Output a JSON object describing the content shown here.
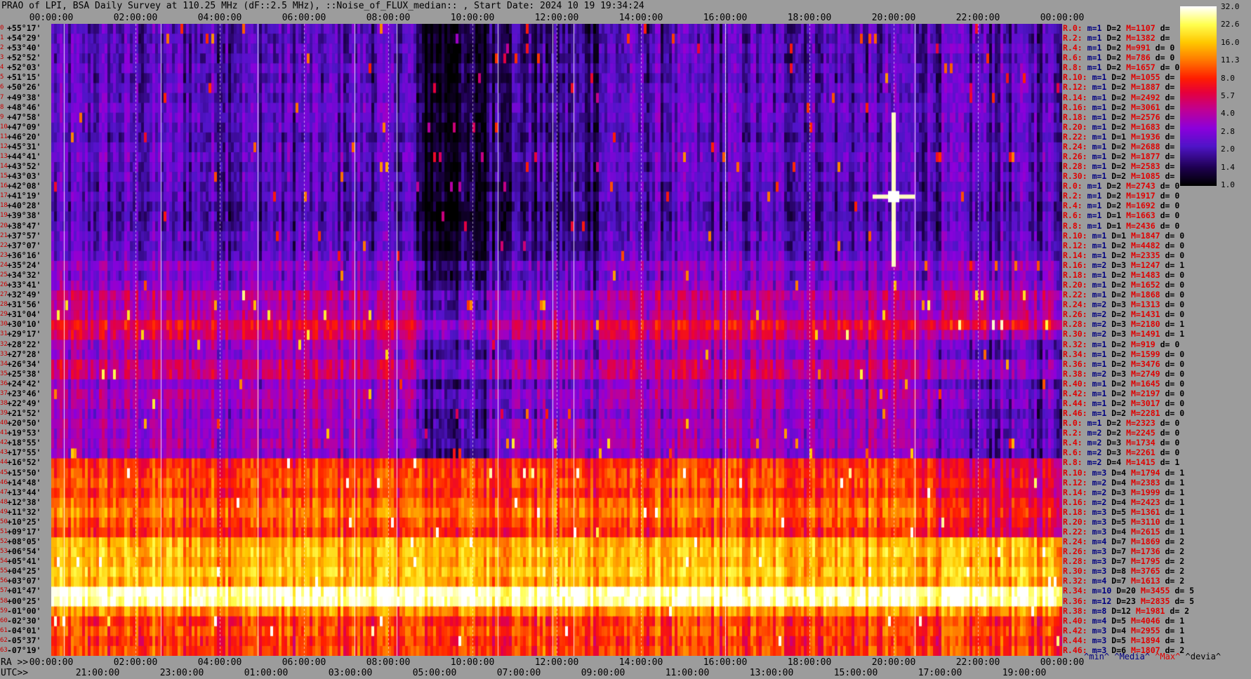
{
  "title": "PRAO of LPI, BSA Daily Survey at 110.25 MHz (dF::2.5 MHz), ::Noise_of_FLUX_median:: , Start Date: 2024 10 19 19:34:24",
  "top_axis_labels": [
    "00:00:00",
    "02:00:00",
    "04:00:00",
    "06:00:00",
    "08:00:00",
    "10:00:00",
    "12:00:00",
    "14:00:00",
    "16:00:00",
    "18:00:00",
    "20:00:00",
    "22:00:00",
    "00:00:00"
  ],
  "ra_prefix": "RA >>",
  "ra_axis_labels": [
    "00:00:00",
    "02:00:00",
    "04:00:00",
    "06:00:00",
    "08:00:00",
    "10:00:00",
    "12:00:00",
    "14:00:00",
    "16:00:00",
    "18:00:00",
    "20:00:00",
    "22:00:00",
    "00:00:00"
  ],
  "utc_prefix": "UTC>>",
  "utc_axis_labels": [
    "21:00:00",
    "23:00:00",
    "01:00:00",
    "03:00:00",
    "05:00:00",
    "07:00:00",
    "09:00:00",
    "11:00:00",
    "13:00:00",
    "15:00:00",
    "17:00:00",
    "19:00:00"
  ],
  "declinations": [
    "+55°17'",
    "+54°29'",
    "+53°40'",
    "+52°52'",
    "+52°03'",
    "+51°15'",
    "+50°26'",
    "+49°38'",
    "+48°46'",
    "+47°58'",
    "+47°09'",
    "+46°20'",
    "+45°31'",
    "+44°41'",
    "+43°52'",
    "+43°03'",
    "+42°08'",
    "+41°19'",
    "+40°28'",
    "+39°38'",
    "+38°47'",
    "+37°57'",
    "+37°07'",
    "+36°16'",
    "+35°24'",
    "+34°32'",
    "+33°41'",
    "+32°49'",
    "+31°56'",
    "+31°04'",
    "+30°10'",
    "+29°17'",
    "+28°22'",
    "+27°28'",
    "+26°34'",
    "+25°38'",
    "+24°42'",
    "+23°46'",
    "+22°49'",
    "+21°52'",
    "+20°50'",
    "+19°53'",
    "+18°55'",
    "+17°55'",
    "+16°52'",
    "+15°50'",
    "+14°48'",
    "+13°44'",
    "+12°38'",
    "+11°32'",
    "+10°25'",
    "+09°17'",
    "+08°05'",
    "+06°54'",
    "+05°41'",
    "+04°25'",
    "+03°07'",
    "+01°47'",
    "+00°25'",
    "-01°00'",
    "-02°30'",
    "-04°01'",
    "-05°37'",
    "-07°19'"
  ],
  "stats_rows": [
    {
      "beam": "R.0:",
      "m": "m=1",
      "D": "D=2",
      "M": "M=1107",
      "d": "d="
    },
    {
      "beam": "R.2:",
      "m": "m=1",
      "D": "D=2",
      "M": "M=1382",
      "d": "d="
    },
    {
      "beam": "R.4:",
      "m": "m=1",
      "D": "D=2",
      "M": "M=991",
      "d": "d= 0"
    },
    {
      "beam": "R.6:",
      "m": "m=1",
      "D": "D=2",
      "M": "M=786",
      "d": "d= 0"
    },
    {
      "beam": "R.8:",
      "m": "m=1",
      "D": "D=2",
      "M": "M=1657",
      "d": "d= 0"
    },
    {
      "beam": "R.10:",
      "m": "m=1",
      "D": "D=2",
      "M": "M=1055",
      "d": "d="
    },
    {
      "beam": "R.12:",
      "m": "m=1",
      "D": "D=2",
      "M": "M=1887",
      "d": "d="
    },
    {
      "beam": "R.14:",
      "m": "m=1",
      "D": "D=2",
      "M": "M=2492",
      "d": "d="
    },
    {
      "beam": "R.16:",
      "m": "m=1",
      "D": "D=2",
      "M": "M=3061",
      "d": "d="
    },
    {
      "beam": "R.18:",
      "m": "m=1",
      "D": "D=2",
      "M": "M=2576",
      "d": "d="
    },
    {
      "beam": "R.20:",
      "m": "m=1",
      "D": "D=2",
      "M": "M=1683",
      "d": "d="
    },
    {
      "beam": "R.22:",
      "m": "m=1",
      "D": "D=1",
      "M": "M=1936",
      "d": "d="
    },
    {
      "beam": "R.24:",
      "m": "m=1",
      "D": "D=2",
      "M": "M=2688",
      "d": "d="
    },
    {
      "beam": "R.26:",
      "m": "m=1",
      "D": "D=2",
      "M": "M=1877",
      "d": "d="
    },
    {
      "beam": "R.28:",
      "m": "m=1",
      "D": "D=2",
      "M": "M=2583",
      "d": "d="
    },
    {
      "beam": "R.30:",
      "m": "m=1",
      "D": "D=2",
      "M": "M=1085",
      "d": "d="
    },
    {
      "beam": "R.0:",
      "m": "m=1",
      "D": "D=2",
      "M": "M=2743",
      "d": "d= 0"
    },
    {
      "beam": "R.2:",
      "m": "m=1",
      "D": "D=2",
      "M": "M=1917",
      "d": "d= 0"
    },
    {
      "beam": "R.4:",
      "m": "m=1",
      "D": "D=2",
      "M": "M=1692",
      "d": "d= 0"
    },
    {
      "beam": "R.6:",
      "m": "m=1",
      "D": "D=1",
      "M": "M=1663",
      "d": "d= 0"
    },
    {
      "beam": "R.8:",
      "m": "m=1",
      "D": "D=1",
      "M": "M=2436",
      "d": "d= 0"
    },
    {
      "beam": "R.10:",
      "m": "m=1",
      "D": "D=1",
      "M": "M=1847",
      "d": "d= 0"
    },
    {
      "beam": "R.12:",
      "m": "m=1",
      "D": "D=2",
      "M": "M=4482",
      "d": "d= 0"
    },
    {
      "beam": "R.14:",
      "m": "m=1",
      "D": "D=2",
      "M": "M=2335",
      "d": "d= 0"
    },
    {
      "beam": "R.16:",
      "m": "m=2",
      "D": "D=3",
      "M": "M=1247",
      "d": "d= 1"
    },
    {
      "beam": "R.18:",
      "m": "m=1",
      "D": "D=2",
      "M": "M=1483",
      "d": "d= 0"
    },
    {
      "beam": "R.20:",
      "m": "m=1",
      "D": "D=2",
      "M": "M=1652",
      "d": "d= 0"
    },
    {
      "beam": "R.22:",
      "m": "m=1",
      "D": "D=2",
      "M": "M=1868",
      "d": "d= 0"
    },
    {
      "beam": "R.24:",
      "m": "m=2",
      "D": "D=3",
      "M": "M=1313",
      "d": "d= 0"
    },
    {
      "beam": "R.26:",
      "m": "m=2",
      "D": "D=2",
      "M": "M=1431",
      "d": "d= 0"
    },
    {
      "beam": "R.28:",
      "m": "m=2",
      "D": "D=3",
      "M": "M=2180",
      "d": "d= 1"
    },
    {
      "beam": "R.30:",
      "m": "m=2",
      "D": "D=3",
      "M": "M=1491",
      "d": "d= 1"
    },
    {
      "beam": "R.32:",
      "m": "m=1",
      "D": "D=2",
      "M": "M=919",
      "d": "d= 0"
    },
    {
      "beam": "R.34:",
      "m": "m=1",
      "D": "D=2",
      "M": "M=1599",
      "d": "d= 0"
    },
    {
      "beam": "R.36:",
      "m": "m=1",
      "D": "D=2",
      "M": "M=3476",
      "d": "d= 0"
    },
    {
      "beam": "R.38:",
      "m": "m=2",
      "D": "D=3",
      "M": "M=2749",
      "d": "d= 0"
    },
    {
      "beam": "R.40:",
      "m": "m=1",
      "D": "D=2",
      "M": "M=1645",
      "d": "d= 0"
    },
    {
      "beam": "R.42:",
      "m": "m=1",
      "D": "D=2",
      "M": "M=2197",
      "d": "d= 0"
    },
    {
      "beam": "R.44:",
      "m": "m=1",
      "D": "D=2",
      "M": "M=3017",
      "d": "d= 0"
    },
    {
      "beam": "R.46:",
      "m": "m=1",
      "D": "D=2",
      "M": "M=2281",
      "d": "d= 0"
    },
    {
      "beam": "R.0:",
      "m": "m=1",
      "D": "D=2",
      "M": "M=2323",
      "d": "d= 0"
    },
    {
      "beam": "R.2:",
      "m": "m=2",
      "D": "D=2",
      "M": "M=2245",
      "d": "d= 0"
    },
    {
      "beam": "R.4:",
      "m": "m=2",
      "D": "D=3",
      "M": "M=1734",
      "d": "d= 0"
    },
    {
      "beam": "R.6:",
      "m": "m=2",
      "D": "D=3",
      "M": "M=2261",
      "d": "d= 0"
    },
    {
      "beam": "R.8:",
      "m": "m=2",
      "D": "D=4",
      "M": "M=1415",
      "d": "d= 1"
    },
    {
      "beam": "R.10:",
      "m": "m=3",
      "D": "D=4",
      "M": "M=1794",
      "d": "d= 1"
    },
    {
      "beam": "R.12:",
      "m": "m=2",
      "D": "D=4",
      "M": "M=2383",
      "d": "d= 1"
    },
    {
      "beam": "R.14:",
      "m": "m=2",
      "D": "D=3",
      "M": "M=1999",
      "d": "d= 1"
    },
    {
      "beam": "R.16:",
      "m": "m=2",
      "D": "D=4",
      "M": "M=2423",
      "d": "d= 1"
    },
    {
      "beam": "R.18:",
      "m": "m=3",
      "D": "D=5",
      "M": "M=1361",
      "d": "d= 1"
    },
    {
      "beam": "R.20:",
      "m": "m=3",
      "D": "D=5",
      "M": "M=3110",
      "d": "d= 1"
    },
    {
      "beam": "R.22:",
      "m": "m=3",
      "D": "D=4",
      "M": "M=2615",
      "d": "d= 1"
    },
    {
      "beam": "R.24:",
      "m": "m=4",
      "D": "D=7",
      "M": "M=1869",
      "d": "d= 2"
    },
    {
      "beam": "R.26:",
      "m": "m=3",
      "D": "D=7",
      "M": "M=1736",
      "d": "d= 2"
    },
    {
      "beam": "R.28:",
      "m": "m=3",
      "D": "D=7",
      "M": "M=1795",
      "d": "d= 2"
    },
    {
      "beam": "R.30:",
      "m": "m=3",
      "D": "D=8",
      "M": "M=3765",
      "d": "d= 2"
    },
    {
      "beam": "R.32:",
      "m": "m=4",
      "D": "D=7",
      "M": "M=1613",
      "d": "d= 2"
    },
    {
      "beam": "R.34:",
      "m": "m=10",
      "D": "D=20",
      "M": "M=3455",
      "d": "d= 5"
    },
    {
      "beam": "R.36:",
      "m": "m=12",
      "D": "D=23",
      "M": "M=2835",
      "d": "d= 5"
    },
    {
      "beam": "R.38:",
      "m": "m=8",
      "D": "D=12",
      "M": "M=1981",
      "d": "d= 2"
    },
    {
      "beam": "R.40:",
      "m": "m=4",
      "D": "D=5",
      "M": "M=4046",
      "d": "d= 1"
    },
    {
      "beam": "R.42:",
      "m": "m=3",
      "D": "D=4",
      "M": "M=2955",
      "d": "d= 1"
    },
    {
      "beam": "R.44:",
      "m": "m=3",
      "D": "D=5",
      "M": "M=1894",
      "d": "d= 1"
    },
    {
      "beam": "R.46:",
      "m": "m=3",
      "D": "D=6",
      "M": "M=1807",
      "d": "d= 2"
    }
  ],
  "legend_footer": {
    "min": "^min^",
    "median": "^Media^",
    "max": "^Max^",
    "devia": "^devia^"
  },
  "colorbar": {
    "labels": [
      "32.0",
      "22.6",
      "16.0",
      "11.3",
      "8.0",
      "5.7",
      "4.0",
      "2.8",
      "2.0",
      "1.4",
      "1.0"
    ],
    "colors": [
      "#ffffff",
      "#ffff80",
      "#ffe000",
      "#ffa000",
      "#ff3000",
      "#e00030",
      "#c0008c",
      "#9000d0",
      "#6020e0",
      "#200060",
      "#000000"
    ]
  },
  "chart_data": {
    "type": "heatmap",
    "title": "PRAO of LPI, BSA Daily Survey at 110.25 MHz (dF::2.5 MHz), ::Noise_of_FLUX_median:: , Start Date: 2024 10 19 19:34:24",
    "x_axis": "RA 00:00:00 → 00:00:00 (24h), UTC 19:34:24 start",
    "y_axis": "Declination, 64 beams, +55°17' → -07°19'",
    "color_scale": "log, 1.0 to 32.0",
    "band_levels": [
      2.0,
      2.0,
      2.1,
      2.0,
      2.2,
      2.0,
      2.2,
      2.1,
      2.3,
      2.2,
      2.1,
      2.0,
      2.2,
      2.3,
      2.1,
      2.2,
      2.0,
      2.1,
      1.9,
      1.9,
      2.0,
      2.2,
      2.1,
      2.3,
      3.0,
      2.6,
      2.9,
      4.2,
      3.6,
      4.0,
      6.0,
      5.0,
      3.4,
      3.2,
      4.6,
      4.6,
      3.0,
      3.8,
      3.6,
      3.0,
      3.4,
      3.2,
      3.5,
      3.0,
      8.0,
      8.5,
      9.0,
      8.0,
      10.0,
      11.0,
      9.0,
      8.0,
      14.0,
      15.0,
      14.0,
      16.0,
      14.0,
      30.0,
      28.0,
      12.0,
      8.0,
      9.0,
      8.0,
      8.5
    ],
    "source_transit": {
      "ra_hours": 20.0,
      "dec": "+41°19'"
    }
  }
}
